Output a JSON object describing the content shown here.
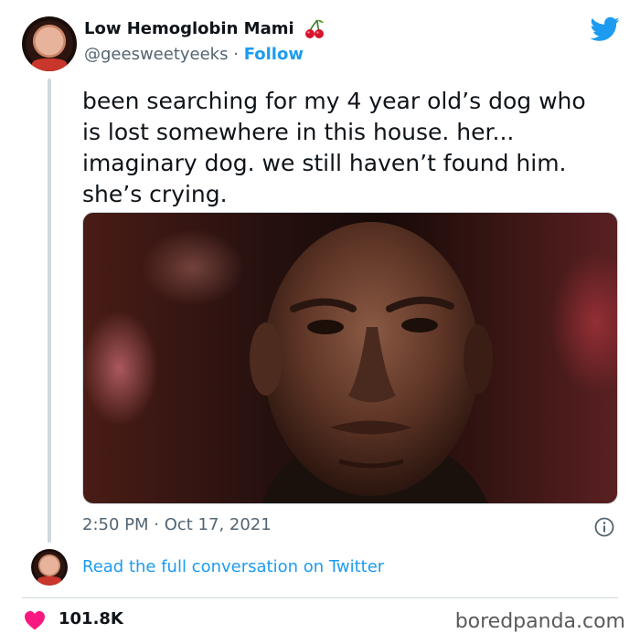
{
  "colors": {
    "accent": "#1d9bf0",
    "text": "#0f1419",
    "secondary": "#536471",
    "like": "#f91880",
    "border": "#cfd9de"
  },
  "author": {
    "name": "Low Hemoglobin Mami",
    "name_emoji_icon": "cherries-icon",
    "handle": "@geesweetyeeks",
    "separator": "·",
    "follow_label": "Follow"
  },
  "tweet": {
    "lines": [
      "been searching for my 4 year old’s dog who",
      "is lost somewhere in this house. her...",
      "imaginary dog. we still haven’t found him.",
      "she’s crying."
    ],
    "timestamp": "2:50 PM · Oct 17, 2021"
  },
  "footer": {
    "read_full": "Read the full conversation on Twitter",
    "likes": "101.8K",
    "watermark": "boredpanda.com"
  },
  "icons": {
    "logo": "twitter-bird-icon",
    "info": "info-icon",
    "like": "heart-icon"
  }
}
